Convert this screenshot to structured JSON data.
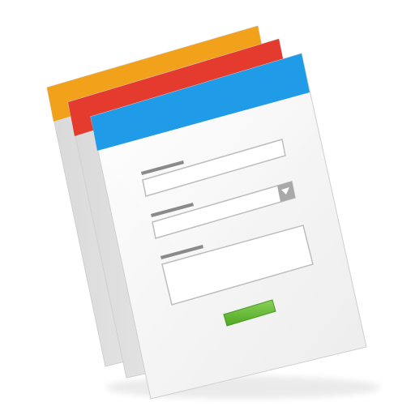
{
  "icon": {
    "name": "web-form-pages-icon",
    "pages": [
      {
        "name": "back-page",
        "header_color": "#F2A21A"
      },
      {
        "name": "middle-page",
        "header_color": "#E53A2E"
      },
      {
        "name": "front-page",
        "header_color": "#1F9BE8"
      }
    ],
    "form": {
      "fields": [
        {
          "name": "text-input",
          "type": "text"
        },
        {
          "name": "select-dropdown",
          "type": "select",
          "has_arrow": true
        },
        {
          "name": "text-input-2",
          "type": "text"
        },
        {
          "name": "textarea",
          "type": "textarea"
        }
      ],
      "submit_button_color": "#5FB830"
    }
  }
}
